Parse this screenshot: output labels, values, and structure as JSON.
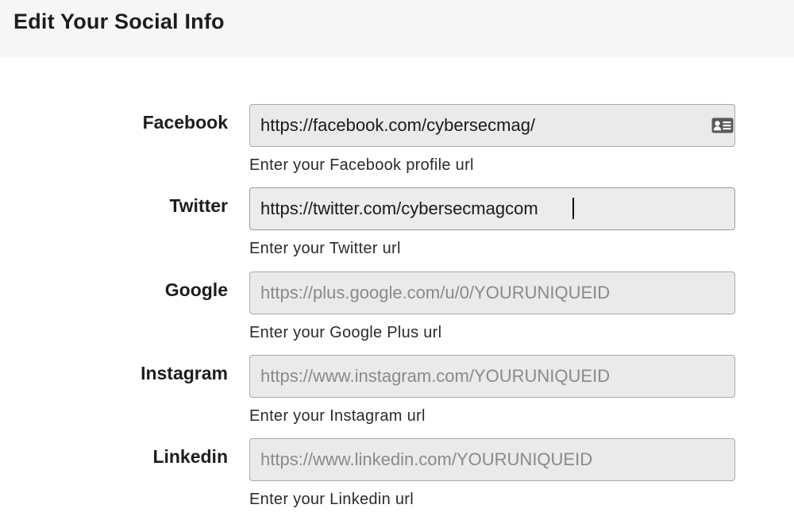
{
  "header": {
    "title": "Edit Your Social Info"
  },
  "fields": [
    {
      "label": "Facebook",
      "value": "https://facebook.com/cybersecmag/",
      "placeholder": "",
      "help": "Enter your Facebook profile url",
      "icon": "contact-card-icon"
    },
    {
      "label": "Twitter",
      "value": "https://twitter.com/cybersecmagcom",
      "placeholder": "",
      "help": "Enter your Twitter url",
      "focused": true
    },
    {
      "label": "Google",
      "value": "",
      "placeholder": "https://plus.google.com/u/0/YOURUNIQUEID",
      "help": "Enter your Google Plus url"
    },
    {
      "label": "Instagram",
      "value": "",
      "placeholder": "https://www.instagram.com/YOURUNIQUEID",
      "help": "Enter your Instagram url"
    },
    {
      "label": "Linkedin",
      "value": "",
      "placeholder": "https://www.linkedin.com/YOURUNIQUEID",
      "help": "Enter your Linkedin url"
    }
  ],
  "colors": {
    "header_bg": "#f6f6f6",
    "input_bg": "#eaeaea",
    "input_border": "#a9a9a9",
    "placeholder": "#8a8a8a"
  }
}
